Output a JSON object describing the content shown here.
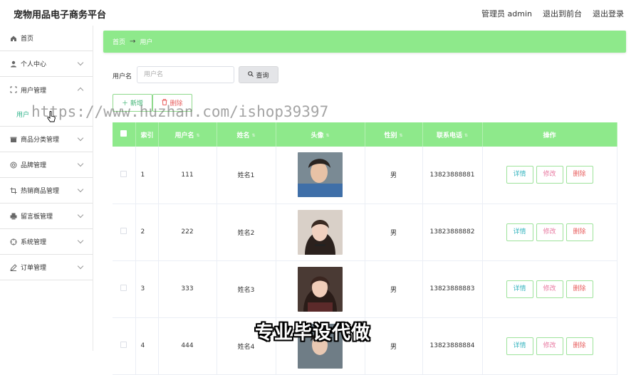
{
  "header": {
    "title": "宠物用品电子商务平台",
    "admin_label": "管理员 admin",
    "back_front": "退出到前台",
    "logout": "退出登录"
  },
  "sidebar": {
    "items": [
      {
        "label": "首页",
        "icon": "home-icon"
      },
      {
        "label": "个人中心",
        "icon": "user-icon"
      },
      {
        "label": "用户管理",
        "icon": "frame-icon",
        "expanded": true
      },
      {
        "label": "商品分类管理",
        "icon": "shop-icon"
      },
      {
        "label": "品牌管理",
        "icon": "target-icon"
      },
      {
        "label": "热销商品管理",
        "icon": "crop-icon"
      },
      {
        "label": "留言板管理",
        "icon": "printer-icon"
      },
      {
        "label": "系统管理",
        "icon": "settings-icon"
      },
      {
        "label": "订单管理",
        "icon": "edit-icon"
      }
    ],
    "sub_item": "用户"
  },
  "breadcrumb": {
    "home": "首页",
    "arrow": "→",
    "current": "用户"
  },
  "search": {
    "label": "用户名",
    "placeholder": "用户名",
    "button": "查询"
  },
  "actions": {
    "add": "新增",
    "delete": "删除"
  },
  "table": {
    "headers": [
      "索引",
      "用户名",
      "姓名",
      "头像",
      "性别",
      "联系电话",
      "操作"
    ],
    "rows": [
      {
        "index": "1",
        "username": "111",
        "name": "姓名1",
        "gender": "男",
        "phone": "13823888881"
      },
      {
        "index": "2",
        "username": "222",
        "name": "姓名2",
        "gender": "男",
        "phone": "13823888882"
      },
      {
        "index": "3",
        "username": "333",
        "name": "姓名3",
        "gender": "男",
        "phone": "13823888883"
      },
      {
        "index": "4",
        "username": "444",
        "name": "姓名4",
        "gender": "男",
        "phone": "13823888884"
      }
    ],
    "row_actions": {
      "detail": "详情",
      "edit": "修改",
      "delete": "删除"
    }
  },
  "overlay": {
    "watermark": "https://www.huzhan.com/ishop39397",
    "caption": "专业毕设代做"
  },
  "colors": {
    "accent_green": "#8ee98b",
    "sub_active": "#2fb38a"
  }
}
